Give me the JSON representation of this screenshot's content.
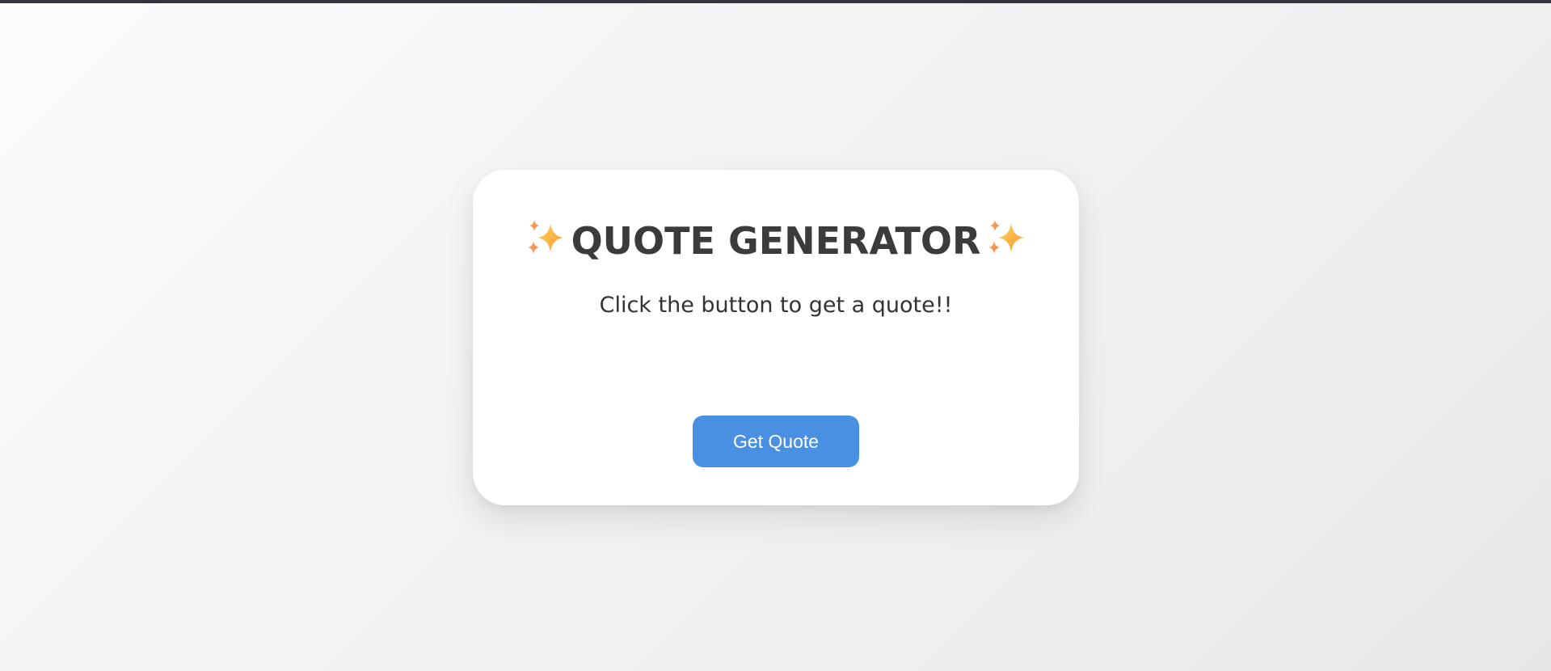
{
  "page": {
    "background_start": "#fdfcfd",
    "background_end": "#e6e7e9",
    "top_bar_color": "#34363f"
  },
  "card": {
    "title": "QUOTE GENERATOR",
    "title_icon": "sparkles-icon",
    "quote_text": "Click the button to get a quote!!",
    "button_label": "Get Quote",
    "button_color": "#4a90e2"
  }
}
